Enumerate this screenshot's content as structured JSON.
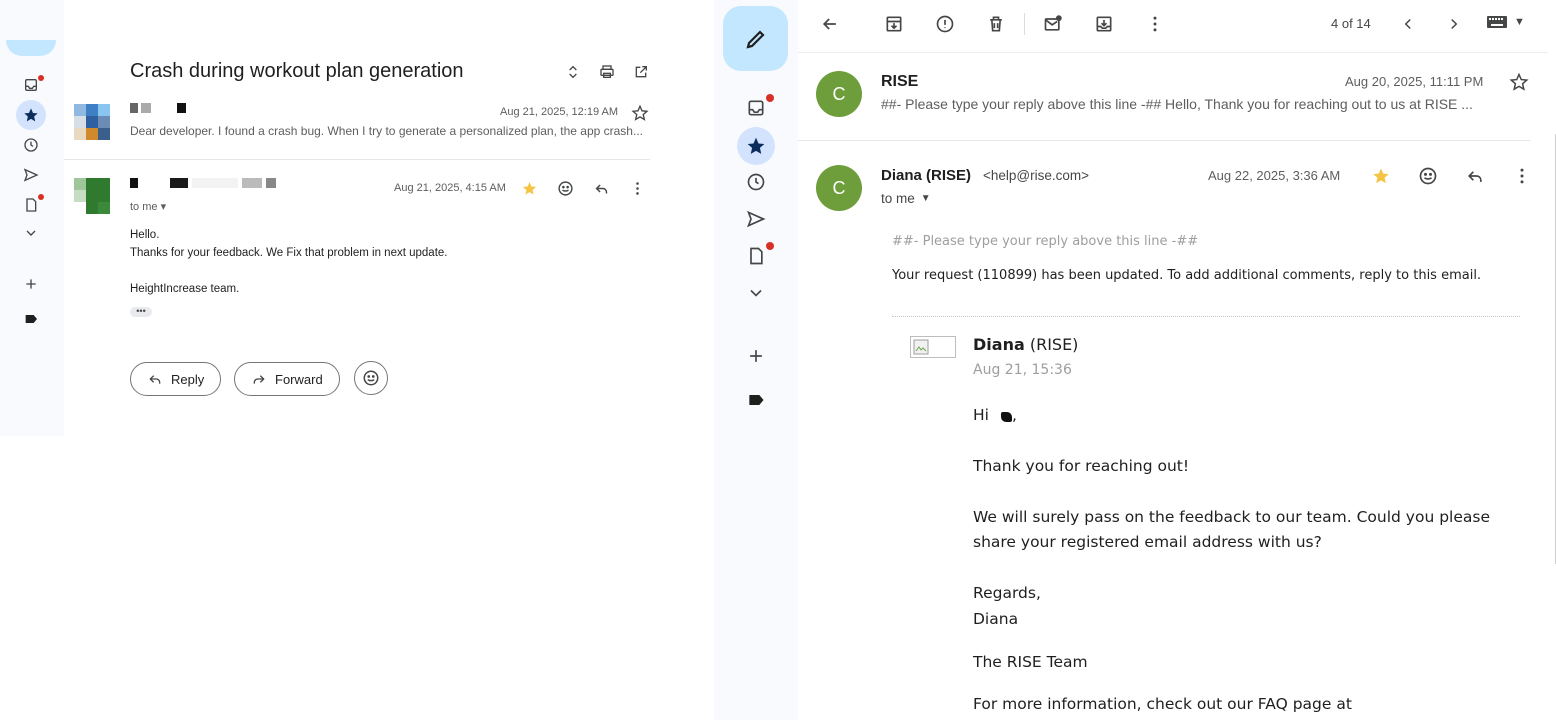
{
  "left_pane": {
    "subject": "Crash during workout plan generation",
    "message1": {
      "date": "Aug 21, 2025, 12:19 AM",
      "snippet": "Dear developer. I found a crash bug. When I try to generate a personalized plan, the app crash..."
    },
    "message2": {
      "date": "Aug 21, 2025, 4:15 AM",
      "to": "to me",
      "body": [
        "Hello.",
        "Thanks for your feedback. We Fix that problem in next update.",
        "",
        "HeightIncrease team."
      ],
      "ellipsis": "•••"
    },
    "buttons": {
      "reply": "Reply",
      "forward": "Forward"
    }
  },
  "right_pane": {
    "toolbar": {
      "count": "4 of 14"
    },
    "message1": {
      "avatar": "C",
      "sender": "RISE",
      "date": "Aug 20, 2025, 11:11 PM",
      "snippet": "##- Please type your reply above this line -## Hello, Thank you for reaching out to us at RISE ..."
    },
    "message2": {
      "avatar": "C",
      "sender": "Diana (RISE)",
      "email": "<help@rise.com>",
      "date": "Aug 22, 2025, 3:36 AM",
      "to": "to me",
      "reply_marker": "##- Please type your reply above this line -##",
      "update_line": "Your request (110899) has been updated. To add additional comments, reply to this email.",
      "quote": {
        "name_bold": "Diana",
        "name_rest": " (RISE)",
        "date": "Aug 21, 15:36",
        "greeting": "Hi",
        "greeting_end": ",",
        "p1": "Thank you for reaching out!",
        "p2": "We will surely pass on the feedback to our team. Could you please share your registered email address with us?",
        "regards": "Regards,",
        "signer": "Diana",
        "team": "The RISE Team",
        "faq": "For more information, check out our FAQ page at"
      }
    }
  },
  "colors": {
    "accent": "#c2e7ff",
    "avatar": "#6e9e3b",
    "star": "#f4c542",
    "unread_dot": "#d93025"
  }
}
